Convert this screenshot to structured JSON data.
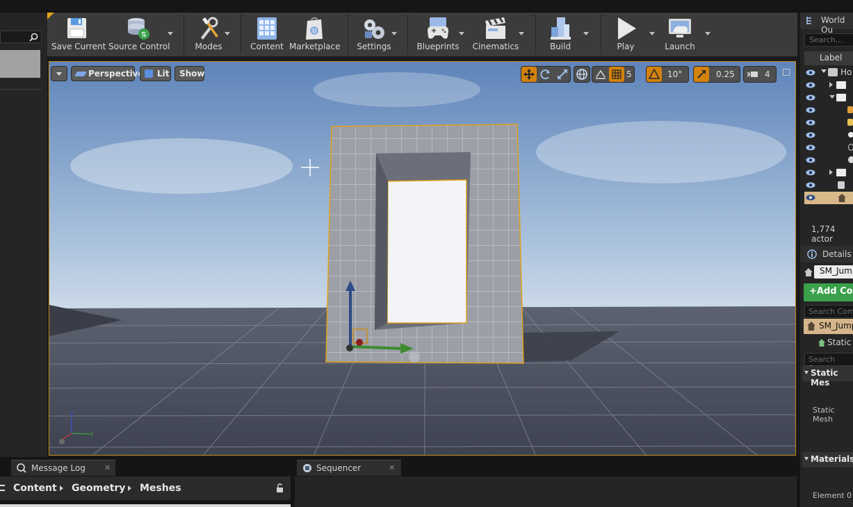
{
  "toolbar": {
    "save_current": "Save Current",
    "source_control": "Source Control",
    "modes": "Modes",
    "content": "Content",
    "marketplace": "Marketplace",
    "settings": "Settings",
    "blueprints": "Blueprints",
    "cinematics": "Cinematics",
    "build": "Build",
    "play": "Play",
    "launch": "Launch"
  },
  "viewport": {
    "perspective": "Perspective",
    "lit": "Lit",
    "show": "Show",
    "grid_snap": "5",
    "rotation_snap": "10°",
    "scale_snap": "0.25",
    "camera_speed": "4"
  },
  "outliner": {
    "title": "World Ou",
    "search_placeholder": "Search...",
    "label_header": "Label",
    "first_item": "Ho",
    "actor_count": "1,774 actor"
  },
  "details": {
    "title": "Details",
    "actor_name": "SM_Jum",
    "add_component": "Add Co",
    "search_components": "Search Com",
    "component_name": "SM_Jump",
    "static_component": "Static",
    "search_details": "Search Detai",
    "static_mesh_section": "Static Mes",
    "static_mesh_label": "Static Mesh",
    "materials_section": "Materials",
    "element_0": "Element 0"
  },
  "bottom": {
    "message_log_tab": "Message Log",
    "sequencer_tab": "Sequencer",
    "breadcrumb": [
      "Content",
      "Geometry",
      "Meshes"
    ]
  },
  "colors": {
    "accent_orange": "#d3820c",
    "selection_outline": "#e1a21b",
    "add_button_green": "#3aa14a"
  }
}
